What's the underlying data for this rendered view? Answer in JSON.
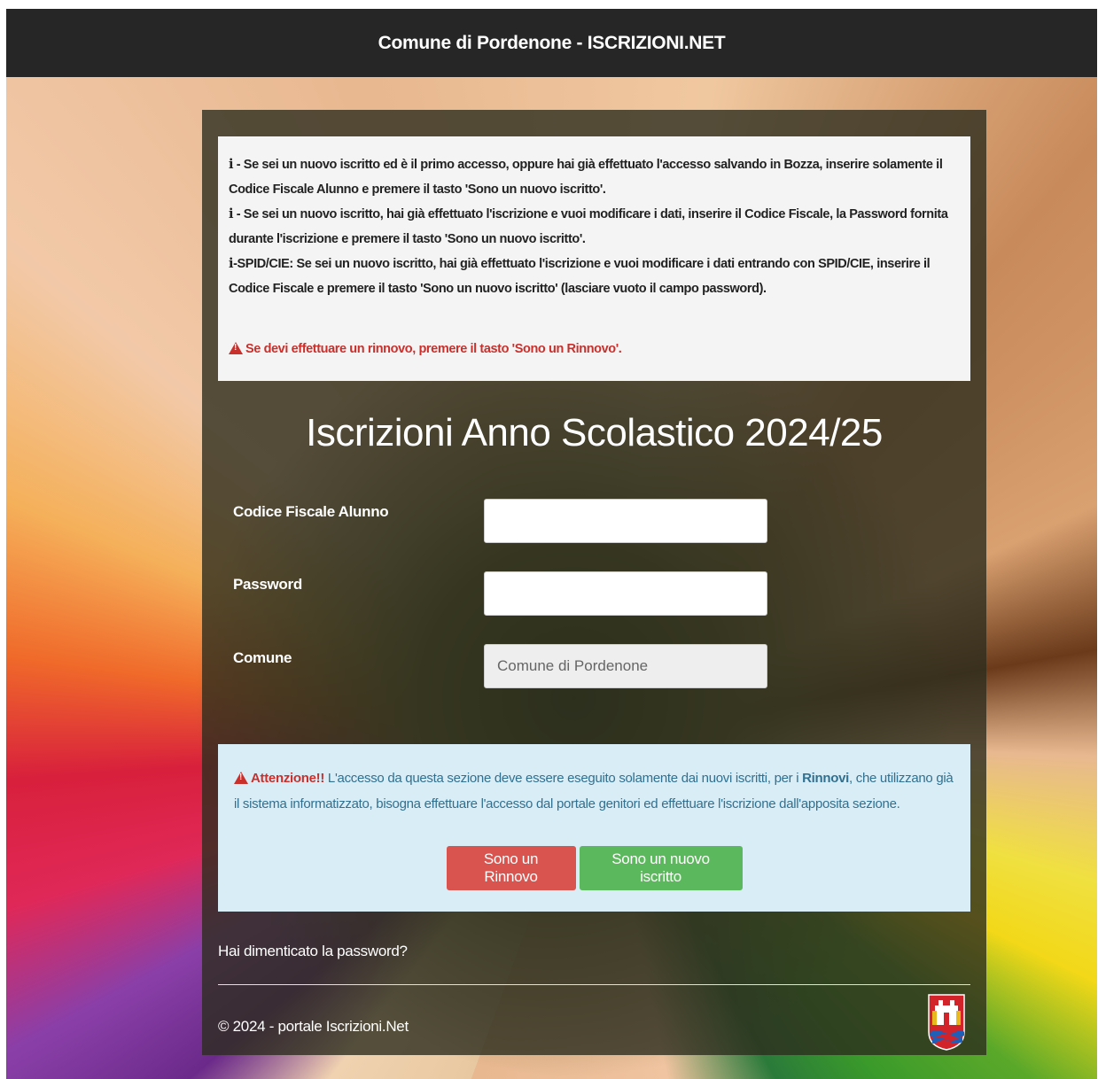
{
  "header": {
    "title": "Comune di Pordenone - ISCRIZIONI.NET"
  },
  "info": {
    "glyph": "i",
    "line1": " - Se sei un nuovo iscritto ed è il primo accesso, oppure hai già effettuato l'accesso salvando in Bozza, inserire solamente il Codice Fiscale Alunno e premere il tasto 'Sono un nuovo iscritto'.",
    "line2": " - Se sei un nuovo iscritto, hai già effettuato l'iscrizione e vuoi modificare i dati, inserire il Codice Fiscale, la Password fornita durante l'iscrizione e premere il tasto 'Sono un nuovo iscritto'.",
    "line3": "-SPID/CIE: Se sei un nuovo iscritto, hai già effettuato l'iscrizione e vuoi modificare i dati entrando con SPID/CIE, inserire il Codice Fiscale e premere il tasto 'Sono un nuovo iscritto' (lasciare vuoto il campo password).",
    "renewal_warning": "Se devi effettuare un rinnovo, premere il tasto 'Sono un Rinnovo'."
  },
  "form": {
    "title": "Iscrizioni Anno Scolastico 2024/25",
    "codice_fiscale_label": "Codice Fiscale Alunno",
    "codice_fiscale_value": "",
    "password_label": "Password",
    "password_value": "",
    "comune_label": "Comune",
    "comune_value": "Comune di Pordenone"
  },
  "alert": {
    "strong": "Attenzione!!",
    "text_before": " L'accesso da questa sezione deve essere eseguito solamente dai nuovi iscritti, per i ",
    "rinnovi": "Rinnovi",
    "text_after": ", che utilizzano già il sistema informatizzato, bisogna effettuare l'accesso dal portale genitori ed effettuare l'iscrizione dall'apposita sezione."
  },
  "buttons": {
    "renewal_label": "Sono un Rinnovo",
    "new_label": "Sono un nuovo iscritto"
  },
  "footer": {
    "forgot_password": "Hai dimenticato la password?",
    "copyright": "© 2024 - portale Iscrizioni.Net"
  },
  "colors": {
    "header_bg": "#262626",
    "danger": "#d9534f",
    "success": "#5cb85c",
    "info_bg": "#d9edf7",
    "info_text": "#31708f",
    "warning_text": "#c9302c"
  },
  "icons": {
    "info": "info-icon",
    "warning": "warning-triangle-icon",
    "crest": "pordenone-crest-icon"
  }
}
